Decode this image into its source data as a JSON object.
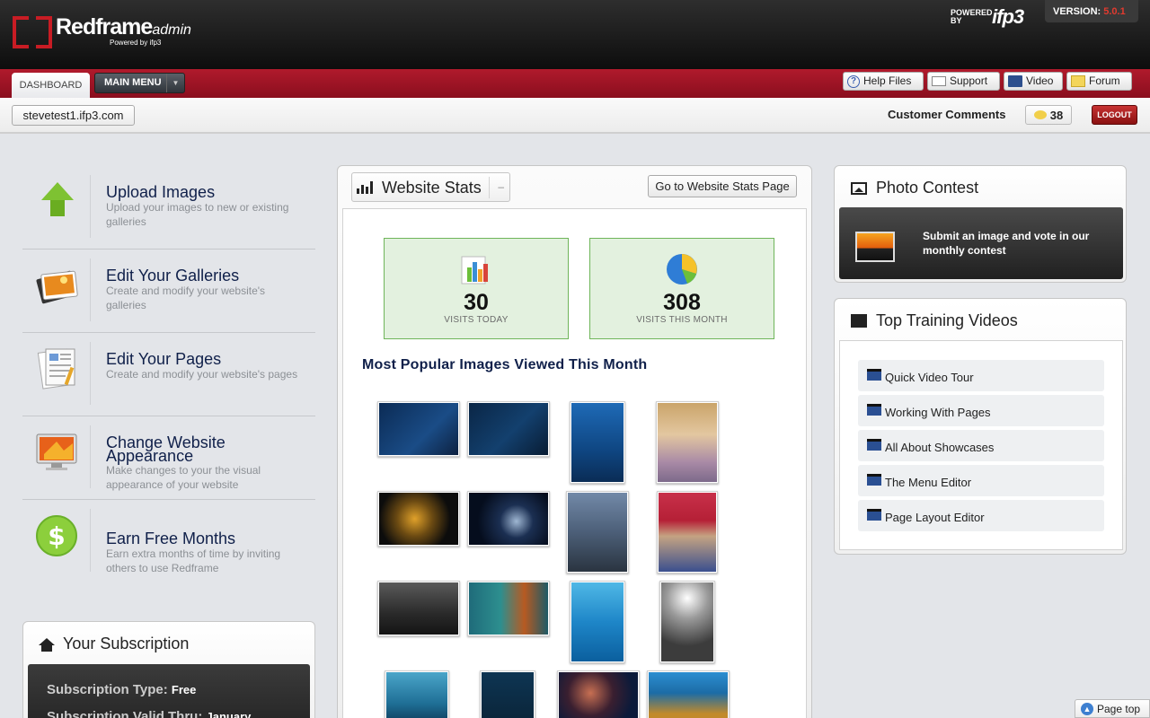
{
  "header": {
    "brand": "Redframe",
    "brand_suffix": "admin",
    "brand_powered": "Powered by ifp3",
    "powered_by_small": "POWERED BY",
    "powered_by_logo": "ifp3",
    "version_label": "VERSION:",
    "version_value": "5.0.1"
  },
  "nav": {
    "dashboard_tab": "DASHBOARD",
    "main_menu": "MAIN MENU",
    "links": [
      {
        "label": "Help Files",
        "icon": "help-icon"
      },
      {
        "label": "Support",
        "icon": "mail-icon"
      },
      {
        "label": "Video",
        "icon": "film-icon"
      },
      {
        "label": "Forum",
        "icon": "note-icon"
      }
    ]
  },
  "subbar": {
    "site": "stevetest1.ifp3.com",
    "comments_label": "Customer Comments",
    "comments_count": "38",
    "logout": "LOGOUT"
  },
  "left_items": [
    {
      "title": "Upload Images",
      "desc": "Upload your images to new or existing galleries",
      "icon": "upload-arrow-icon"
    },
    {
      "title": "Edit Your Galleries",
      "desc": "Create and modify your website's galleries",
      "icon": "galleries-icon"
    },
    {
      "title": "Edit Your Pages",
      "desc": "Create and modify your website's pages",
      "icon": "pages-icon"
    },
    {
      "title": "Change Website Appearance",
      "desc": "Make changes to your the visual appearance of your website",
      "icon": "monitor-icon"
    },
    {
      "title": "Earn Free Months",
      "desc": "Earn extra months of time by inviting others to use Redframe",
      "icon": "dollar-icon"
    }
  ],
  "subscription": {
    "title": "Your Subscription",
    "type_label": "Subscription Type:",
    "type_value": "Free",
    "valid_label": "Subscription Valid Thru:",
    "valid_value": "January"
  },
  "stats": {
    "title": "Website Stats",
    "collapse": "–",
    "goto_button": "Go to Website Stats Page",
    "visits_today": "30",
    "visits_today_label": "VISITS TODAY",
    "visits_month": "308",
    "visits_month_label": "VISITS THIS MONTH",
    "popular_title": "Most Popular Images Viewed This Month"
  },
  "photo_contest": {
    "title": "Photo Contest",
    "text": "Submit an image and vote in our monthly contest"
  },
  "training": {
    "title": "Top Training Videos",
    "videos": [
      "Quick Video Tour",
      "Working With Pages",
      "All About Showcases",
      "The Menu Editor",
      "Page Layout Editor"
    ]
  },
  "page_top": "Page top",
  "colors": {
    "brand_red": "#c81c24",
    "nav_red": "#9d1526",
    "stat_green_bg": "#e3f1df",
    "stat_green_border": "#6fb55a",
    "title_navy": "#10204a"
  }
}
